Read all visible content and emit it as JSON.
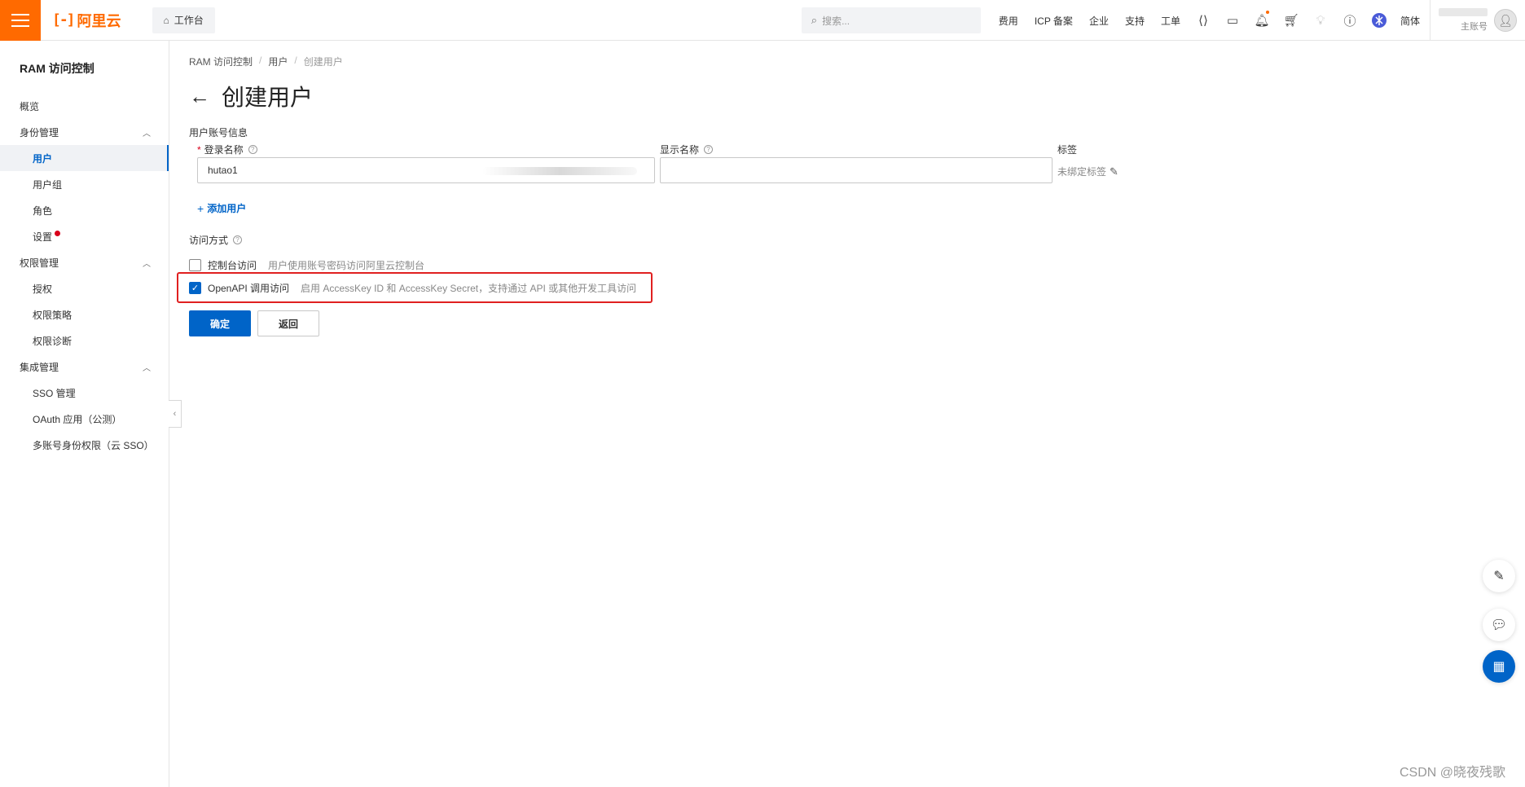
{
  "topbar": {
    "brand": "阿里云",
    "logo_mark": "[-]",
    "workbench": "工作台",
    "search_placeholder": "搜索...",
    "links": [
      "费用",
      "ICP 备案",
      "企业",
      "支持",
      "工单"
    ],
    "lang": "简体",
    "account_role": "主账号"
  },
  "sidebar": {
    "title": "RAM 访问控制",
    "overview": "概览",
    "groups": [
      {
        "label": "身份管理",
        "items": [
          "用户",
          "用户组",
          "角色",
          "设置"
        ]
      },
      {
        "label": "权限管理",
        "items": [
          "授权",
          "权限策略",
          "权限诊断"
        ]
      },
      {
        "label": "集成管理",
        "items": [
          "SSO 管理",
          "OAuth 应用（公测）",
          "多账号身份权限（云 SSO）"
        ]
      }
    ],
    "active_item": "用户"
  },
  "breadcrumb": [
    "RAM 访问控制",
    "用户",
    "创建用户"
  ],
  "page_title": "创建用户",
  "form": {
    "section_label": "用户账号信息",
    "login_name_label": "登录名称",
    "login_name_value": "hutao1",
    "display_name_label": "显示名称",
    "display_name_value": "",
    "tag_label": "标签",
    "tag_value": "未绑定标签",
    "add_user": "添加用户",
    "access_label": "访问方式",
    "console_access": {
      "title": "控制台访问",
      "desc": "用户使用账号密码访问阿里云控制台",
      "checked": false
    },
    "openapi_access": {
      "title": "OpenAPI 调用访问",
      "desc": "启用 AccessKey ID 和 AccessKey Secret，支持通过 API 或其他开发工具访问",
      "checked": true
    },
    "confirm": "确定",
    "back": "返回"
  },
  "watermark": "CSDN @晓夜残歌",
  "colors": {
    "brand": "#ff6a00",
    "primary": "#0064c8",
    "highlight": "#e02020"
  }
}
